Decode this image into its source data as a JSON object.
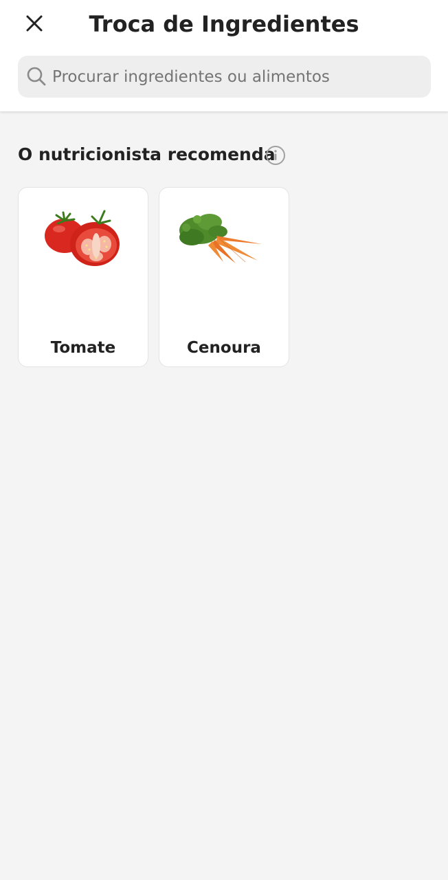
{
  "header": {
    "title": "Troca de Ingredientes",
    "close_icon": "close-icon"
  },
  "search": {
    "placeholder": "Procurar ingredientes ou alimentos",
    "value": "",
    "icon": "search-icon"
  },
  "recommendations": {
    "title": "O nutricionista recomenda",
    "info_icon": "info-icon",
    "items": [
      {
        "label": "Tomate",
        "image": "tomato-image"
      },
      {
        "label": "Cenoura",
        "image": "carrot-image"
      }
    ]
  },
  "colors": {
    "header_bg": "#ffffff",
    "page_bg": "#f4f4f4",
    "search_bg": "#eeeeee",
    "text": "#222222",
    "placeholder": "#747474",
    "icon_gray": "#8a8a8a"
  }
}
